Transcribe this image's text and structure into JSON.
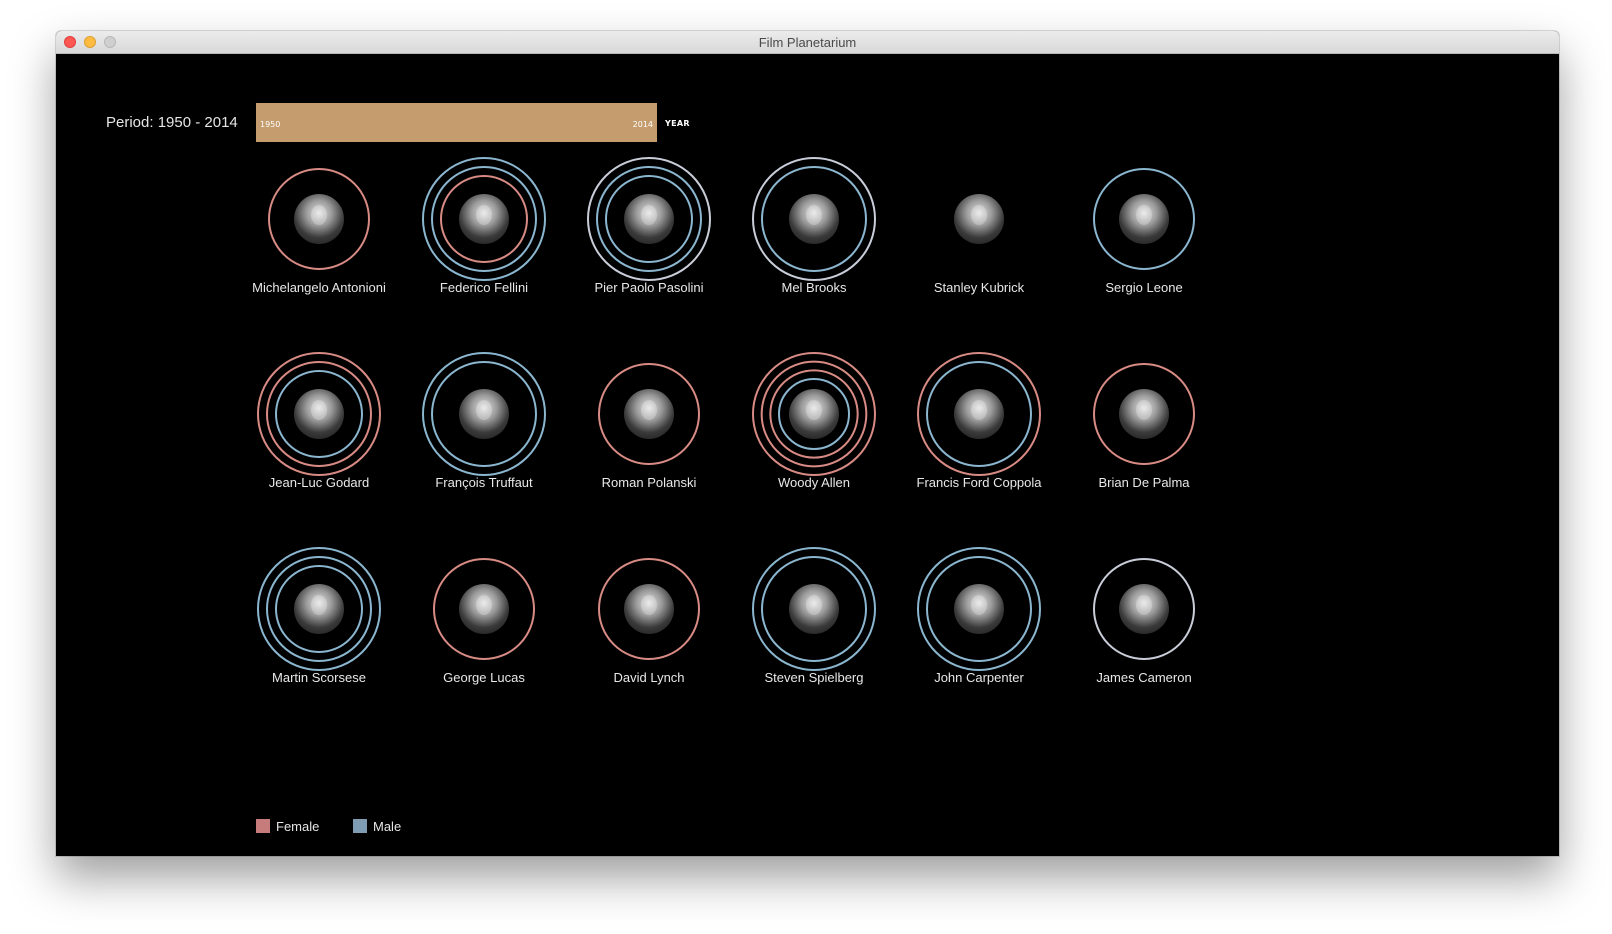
{
  "window": {
    "title": "Film Planetarium"
  },
  "period": {
    "label": "Period: 1950 - 2014",
    "start": "1950",
    "end": "2014",
    "axis_label": "YEAR",
    "bar_color": "#c49c6d"
  },
  "colors": {
    "female": "#d88b84",
    "male": "#8bb6cf",
    "mixed": "#c9cdd9"
  },
  "legend": [
    {
      "label": "Female",
      "color": "#c77c7c"
    },
    {
      "label": "Male",
      "color": "#7e9db4"
    }
  ],
  "directors": [
    {
      "name": "Michelangelo Antonioni",
      "rings": [
        "female"
      ]
    },
    {
      "name": "Federico Fellini",
      "rings": [
        "male",
        "male",
        "female"
      ]
    },
    {
      "name": "Pier Paolo Pasolini",
      "rings": [
        "mixed",
        "male",
        "male"
      ]
    },
    {
      "name": "Mel Brooks",
      "rings": [
        "mixed",
        "male"
      ]
    },
    {
      "name": "Stanley Kubrick",
      "rings": []
    },
    {
      "name": "Sergio Leone",
      "rings": [
        "male"
      ]
    },
    {
      "name": "Jean-Luc Godard",
      "rings": [
        "female",
        "female",
        "male"
      ]
    },
    {
      "name": "François Truffaut",
      "rings": [
        "male",
        "male"
      ]
    },
    {
      "name": "Roman Polanski",
      "rings": [
        "female"
      ]
    },
    {
      "name": "Woody Allen",
      "rings": [
        "female",
        "female",
        "female",
        "male"
      ]
    },
    {
      "name": "Francis Ford Coppola",
      "rings": [
        "female",
        "male"
      ]
    },
    {
      "name": "Brian De Palma",
      "rings": [
        "female"
      ]
    },
    {
      "name": "Martin Scorsese",
      "rings": [
        "male",
        "male",
        "male"
      ]
    },
    {
      "name": "George Lucas",
      "rings": [
        "female"
      ]
    },
    {
      "name": "David Lynch",
      "rings": [
        "female"
      ]
    },
    {
      "name": "Steven Spielberg",
      "rings": [
        "male",
        "male"
      ]
    },
    {
      "name": "John Carpenter",
      "rings": [
        "male",
        "male"
      ]
    },
    {
      "name": "James Cameron",
      "rings": [
        "mixed"
      ]
    }
  ]
}
